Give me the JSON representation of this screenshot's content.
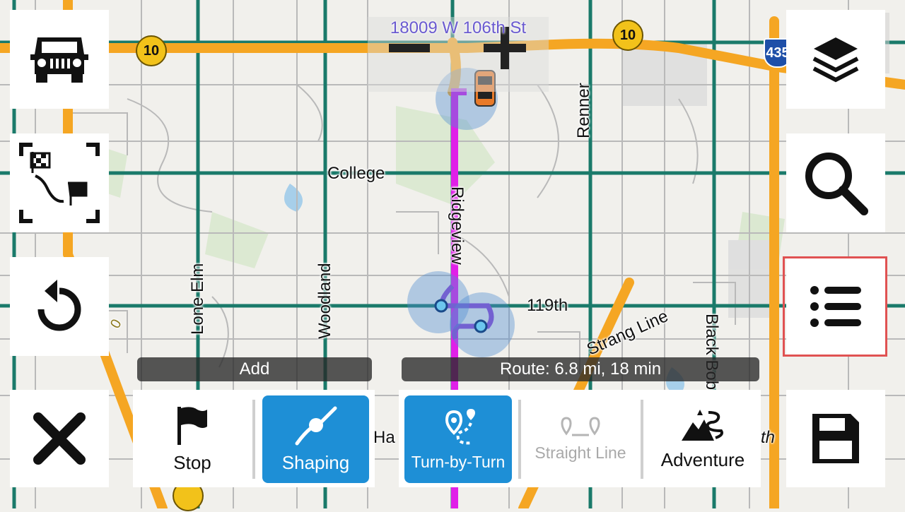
{
  "map": {
    "address": "18009 W 106th St",
    "roads": {
      "college": "College",
      "ridgeview": "Ridgeview",
      "renner": "Renner",
      "lone_elm": "Lone Elm",
      "woodland": "Woodland",
      "s119th": "119th",
      "strang_line": "Strang Line",
      "black_bob": "Black Bob",
      "ha_partial": "Ha",
      "th_partial": "th",
      "sign_o": "0"
    },
    "shields": {
      "k10_left": "10",
      "k10_right": "10",
      "interstate": "435"
    }
  },
  "zoom": {
    "out_label": "−",
    "in_label": "+"
  },
  "labels": {
    "add": "Add",
    "route": "Route: 6.8 mi, 18 min"
  },
  "add_panel": {
    "stop": "Stop",
    "shaping": "Shaping"
  },
  "route_panel": {
    "turn_by_turn": "Turn-by-Turn",
    "straight_line": "Straight Line",
    "adventure": "Adventure"
  },
  "colors": {
    "route": "#e020e8",
    "active": "#1e8fd6",
    "highway": "#f5a623",
    "arterial": "#1a7a6a",
    "highlight": "#e05252"
  }
}
